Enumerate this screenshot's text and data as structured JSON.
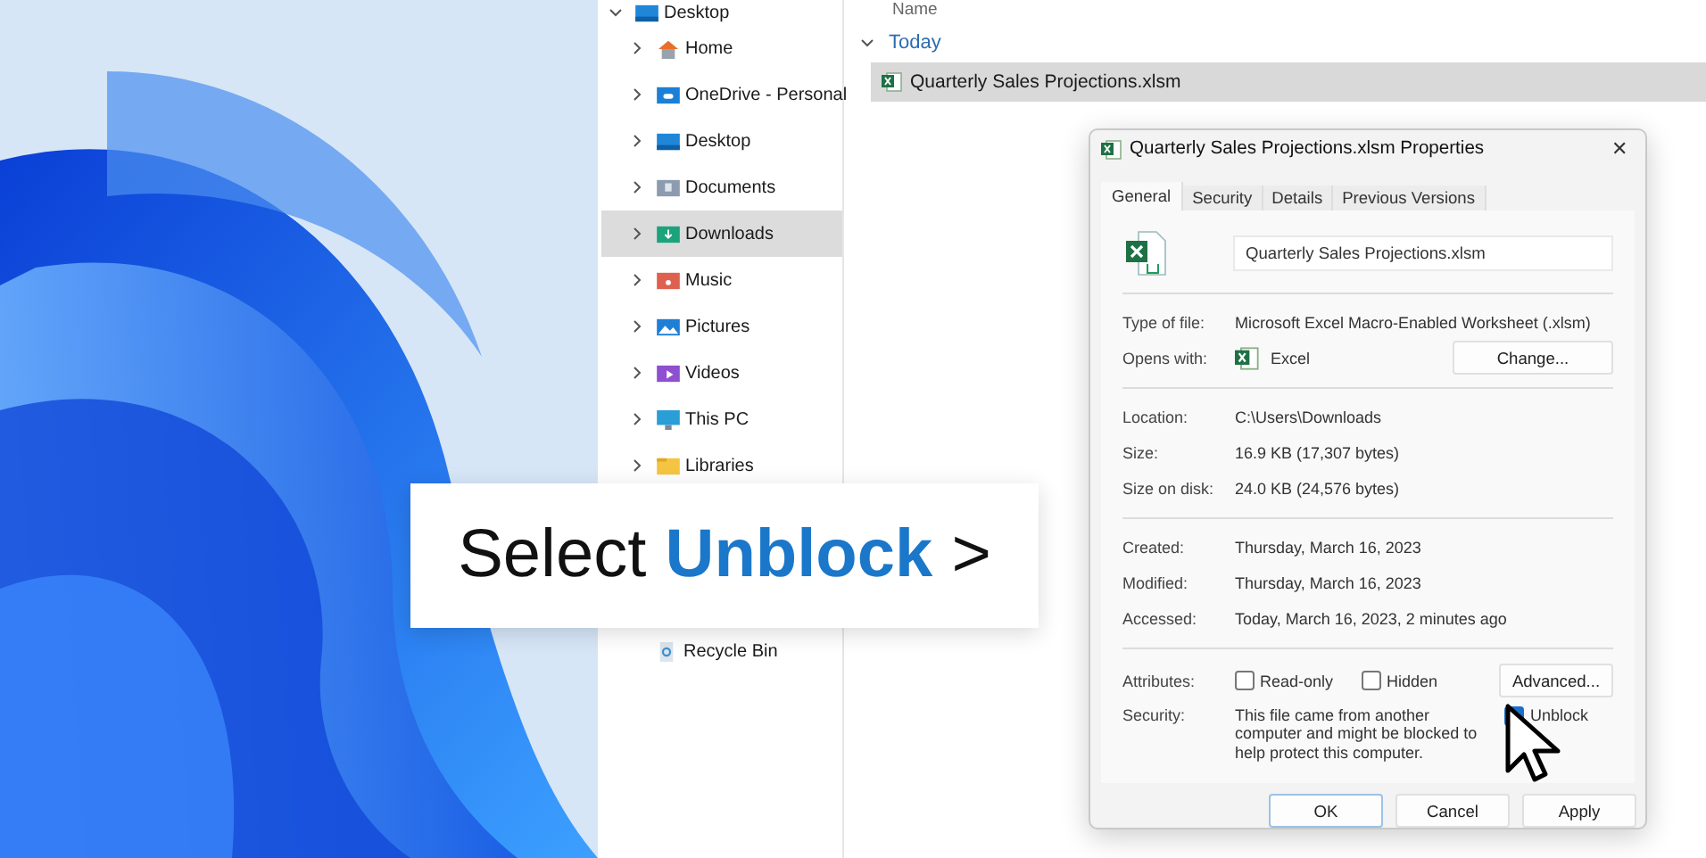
{
  "nav": {
    "items": [
      {
        "label": "Desktop",
        "kind": "desktop",
        "expanded": true,
        "selected": false,
        "children": [
          {
            "label": "Home",
            "kind": "home",
            "expanded": false,
            "selected": false
          },
          {
            "label": "OneDrive - Personal",
            "kind": "cloud",
            "expanded": false,
            "selected": false
          },
          {
            "label": "Desktop",
            "kind": "desktop",
            "expanded": false,
            "selected": false
          },
          {
            "label": "Documents",
            "kind": "documents",
            "expanded": false,
            "selected": false
          },
          {
            "label": "Downloads",
            "kind": "downloads",
            "expanded": false,
            "selected": true
          },
          {
            "label": "Music",
            "kind": "music",
            "expanded": false,
            "selected": false
          },
          {
            "label": "Pictures",
            "kind": "pictures",
            "expanded": false,
            "selected": false
          },
          {
            "label": "Videos",
            "kind": "videos",
            "expanded": false,
            "selected": false
          },
          {
            "label": "This PC",
            "kind": "pc",
            "expanded": false,
            "selected": false
          },
          {
            "label": "Libraries",
            "kind": "folder",
            "expanded": false,
            "selected": false
          }
        ]
      }
    ],
    "lower_items": [
      {
        "label": "Recycle Bin",
        "kind": "recycle"
      }
    ]
  },
  "file_list": {
    "column": "Name",
    "groups": [
      {
        "label": "Today",
        "expanded": true,
        "files": [
          {
            "name": "Quarterly Sales Projections.xlsm",
            "selected": true
          }
        ]
      }
    ]
  },
  "dialog": {
    "title": "Quarterly Sales Projections.xlsm Properties",
    "close": "✕",
    "tabs": [
      {
        "label": "General",
        "selected": true
      },
      {
        "label": "Security",
        "selected": false
      },
      {
        "label": "Details",
        "selected": false
      },
      {
        "label": "Previous Versions",
        "selected": false
      }
    ],
    "file_name": "Quarterly Sales Projections.xlsm",
    "sections": [
      [
        {
          "kind": "text",
          "label": "Type of file:",
          "value": "Microsoft Excel Macro-Enabled Worksheet (.xlsm)"
        },
        {
          "kind": "app",
          "label": "Opens with:",
          "value": "Excel",
          "button": "Change..."
        }
      ],
      [
        {
          "kind": "text",
          "label": "Location:",
          "value": "C:\\Users\\Downloads"
        },
        {
          "kind": "text",
          "label": "Size:",
          "value": "16.9 KB (17,307 bytes)"
        },
        {
          "kind": "text",
          "label": "Size on disk:",
          "value": "24.0 KB (24,576 bytes)"
        }
      ],
      [
        {
          "kind": "text",
          "label": "Created:",
          "value": "Thursday, March 16, 2023"
        },
        {
          "kind": "text",
          "label": "Modified:",
          "value": "Thursday, March 16, 2023"
        },
        {
          "kind": "text",
          "label": "Accessed:",
          "value": "Today, March 16, 2023, 2 minutes ago"
        }
      ],
      [
        {
          "kind": "attributes",
          "label": "Attributes:",
          "options": [
            {
              "label": "Read-only",
              "checked": false
            },
            {
              "label": "Hidden",
              "checked": false
            }
          ],
          "button": "Advanced..."
        },
        {
          "kind": "security",
          "label": "Security:",
          "value": "This file came from another computer and might be blocked to help protect this computer.",
          "option": {
            "label": "Unblock",
            "checked": true
          }
        }
      ]
    ],
    "buttons": [
      {
        "label": "OK",
        "default": true
      },
      {
        "label": "Cancel",
        "default": false
      },
      {
        "label": "Apply",
        "default": false
      }
    ]
  },
  "caption": {
    "lead": "Select",
    "highlight": "Unblock",
    "arrow": ">"
  }
}
